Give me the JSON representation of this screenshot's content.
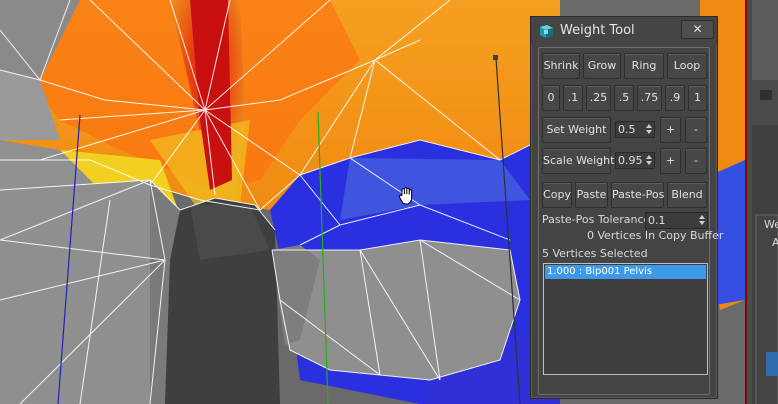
{
  "window": {
    "title": "Weight Tool",
    "close_label": "✕"
  },
  "buttons": {
    "shrink": "Shrink",
    "grow": "Grow",
    "ring": "Ring",
    "loop": "Loop"
  },
  "presets": [
    "0",
    ".1",
    ".25",
    ".5",
    ".75",
    ".9",
    "1"
  ],
  "set_weight": {
    "label": "Set Weight",
    "value": "0.5",
    "plus": "+",
    "minus": "-"
  },
  "scale_weight": {
    "label": "Scale Weight",
    "value": "0.95",
    "plus": "+",
    "minus": "-"
  },
  "clipboard": {
    "copy": "Copy",
    "paste": "Paste",
    "paste_pos": "Paste-Pos",
    "blend": "Blend"
  },
  "tolerance": {
    "label": "Paste-Pos Tolerance",
    "value": "0.1"
  },
  "status": {
    "copy_buffer": "0 Vertices In Copy Buffer",
    "selected": "5 Vertices Selected"
  },
  "weights_list": [
    "1.000 : Bip001 Pelvis"
  ],
  "side_panel": {
    "text_1": "We",
    "text_2": "A"
  },
  "icons": {
    "app": "3ds-max-icon",
    "cursor": "hand-cursor-icon"
  }
}
